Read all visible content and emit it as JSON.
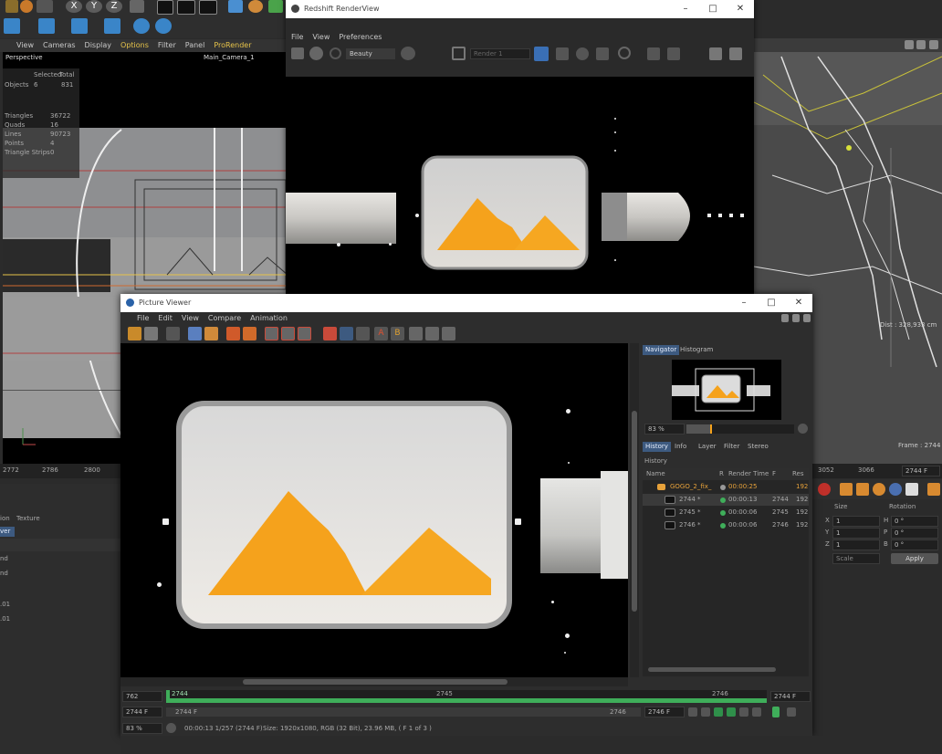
{
  "app": {
    "menubar": [
      "View",
      "Cameras",
      "Display",
      "Options",
      "Filter",
      "Panel",
      "ProRender"
    ],
    "axis_buttons": [
      "X",
      "Y",
      "Z"
    ]
  },
  "viewport": {
    "name": "Perspective",
    "camera": "Main_Camera_1",
    "stats_header": [
      "Selected",
      "Total"
    ],
    "stats": [
      {
        "label": "Objects",
        "selected": "6",
        "total": "831"
      },
      {
        "label": "Triangles",
        "selected": "",
        "total": "36722"
      },
      {
        "label": "Quads",
        "selected": "",
        "total": "16"
      },
      {
        "label": "Lines",
        "selected": "",
        "total": "90723"
      },
      {
        "label": "Points",
        "selected": "",
        "total": "4"
      },
      {
        "label": "Triangle Strips",
        "selected": "",
        "total": "0"
      }
    ],
    "timeline_ticks": [
      "2772",
      "2786",
      "2800"
    ]
  },
  "attributes_left": {
    "tabs": [
      "ion",
      "Texture"
    ],
    "highlight": "ver",
    "rows": [
      "nd",
      "nd",
      ".01",
      ".01"
    ]
  },
  "right_viewport": {
    "distance": "Dist : 328,933 cm",
    "frame": "Frame : 2744",
    "timeline_ticks": [
      "3052",
      "3066"
    ],
    "frame_field": "2744 F"
  },
  "coords": {
    "headers": [
      "Size",
      "Rotation"
    ],
    "rows": [
      {
        "axis": "X",
        "size": "1",
        "rot_axis": "H",
        "rot": "0 °"
      },
      {
        "axis": "Y",
        "size": "1",
        "rot_axis": "P",
        "rot": "0 °"
      },
      {
        "axis": "Z",
        "size": "1",
        "rot_axis": "B",
        "rot": "0 °"
      }
    ],
    "mode": "Scale",
    "apply": "Apply"
  },
  "redshift": {
    "title": "Redshift RenderView",
    "menu": [
      "File",
      "View",
      "Preferences"
    ],
    "aov": "Beauty",
    "render_field": "Render 1"
  },
  "picture_viewer": {
    "title": "Picture Viewer",
    "menu": [
      "File",
      "Edit",
      "View",
      "Compare",
      "Animation"
    ],
    "nav_tabs": [
      "Navigator",
      "Histogram"
    ],
    "zoom": "83 %",
    "hist_tabs": [
      "History",
      "Info",
      "Layer",
      "Filter",
      "Stereo"
    ],
    "history_label": "History",
    "columns": [
      "Name",
      "R",
      "Render Time",
      "F",
      "Res"
    ],
    "rows": [
      {
        "name": "GOGO_2_fix_",
        "time": "00:00:25",
        "frame": "",
        "res": "192",
        "folder": true
      },
      {
        "name": "2744 *",
        "time": "00:00:13",
        "frame": "2744",
        "res": "192",
        "folder": false
      },
      {
        "name": "2745 *",
        "time": "00:00:06",
        "frame": "2745",
        "res": "192",
        "folder": false
      },
      {
        "name": "2746 *",
        "time": "00:00:06",
        "frame": "2746",
        "res": "192",
        "folder": false
      }
    ],
    "timeline": {
      "left_field": "762",
      "marks": [
        "2744",
        "2745",
        "2746"
      ],
      "end_field": "2744 F",
      "start_field": "2744 F",
      "start_inner": "2744 F",
      "end_inner": "2746",
      "cur_field": "2746 F"
    },
    "status": {
      "zoom": "83 %",
      "time": "00:00:13 1/257 (2744 F)",
      "size": "Size: 1920x1080, RGB (32 Bit), 23.96 MB,  ( F 1 of 3 )"
    }
  },
  "colors": {
    "accent_orange": "#f5a21c",
    "selection_blue": "#3d5a80",
    "green_timeline": "#3fae5a",
    "dark_bg": "#262626",
    "render_bg": "#000000"
  }
}
